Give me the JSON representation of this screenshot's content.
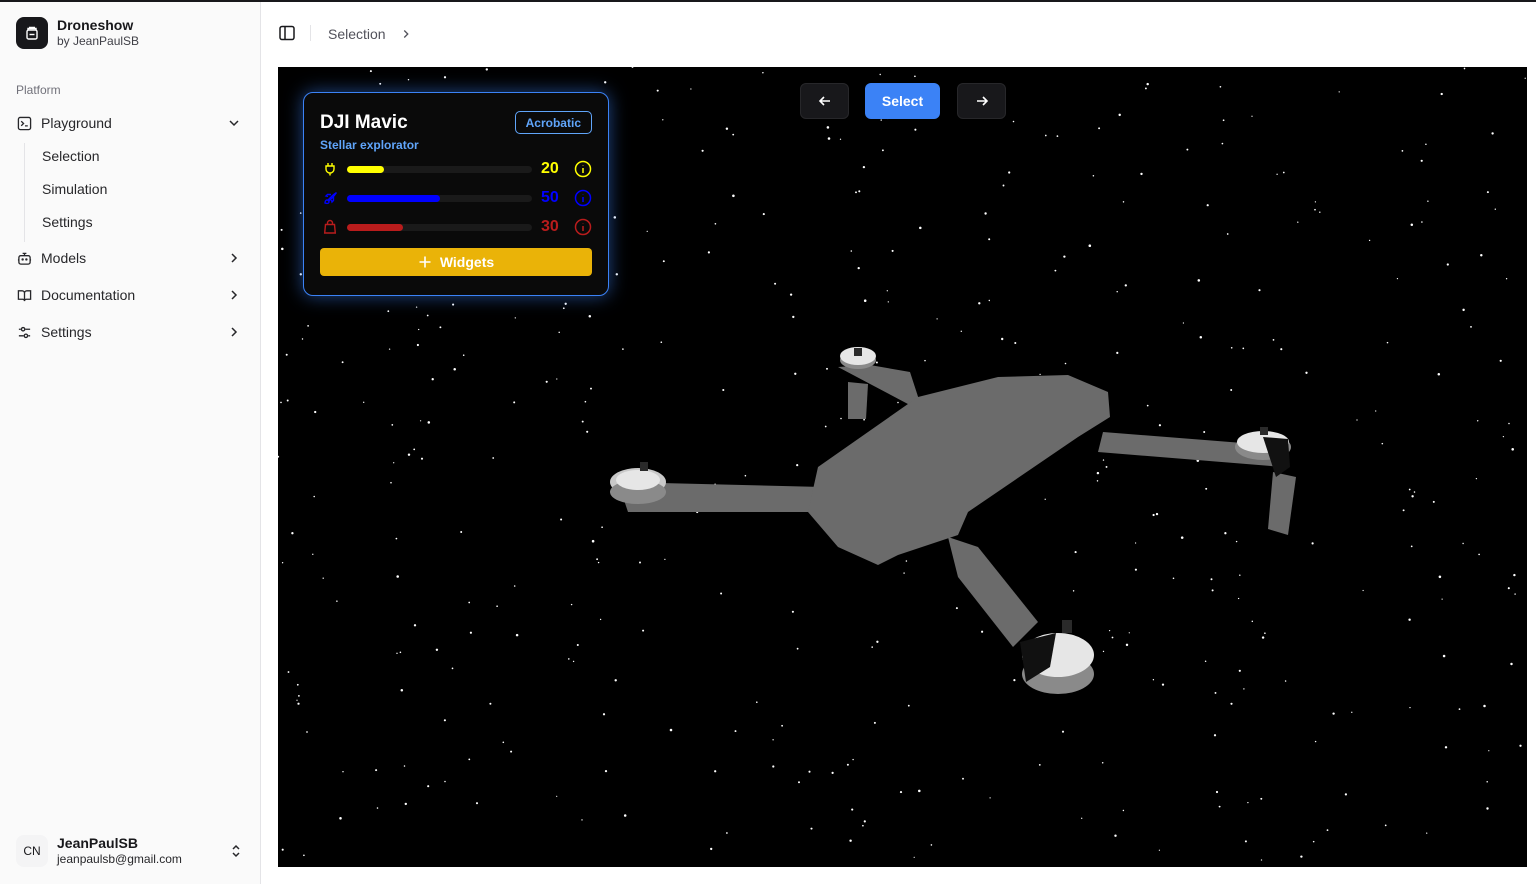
{
  "brand": {
    "name": "Droneshow",
    "subtitle": "by JeanPaulSB"
  },
  "sidebar": {
    "section_label": "Platform",
    "items": [
      {
        "label": "Playground",
        "icon": "terminal-square-icon",
        "expanded": true,
        "children": [
          {
            "label": "Selection"
          },
          {
            "label": "Simulation"
          },
          {
            "label": "Settings"
          }
        ]
      },
      {
        "label": "Models",
        "icon": "bot-icon"
      },
      {
        "label": "Documentation",
        "icon": "book-open-icon"
      },
      {
        "label": "Settings",
        "icon": "sliders-icon"
      }
    ]
  },
  "user": {
    "initials": "CN",
    "name": "JeanPaulSB",
    "email": "jeanpaulsb@gmail.com"
  },
  "header": {
    "breadcrumb": "Selection"
  },
  "scene": {
    "select_label": "Select",
    "card": {
      "title": "DJI Mavic",
      "badge": "Acrobatic",
      "subtitle": "Stellar explorator",
      "stats": [
        {
          "icon": "plug-icon",
          "value": "20",
          "percent": 20,
          "color": "#ffff00"
        },
        {
          "icon": "rocket-icon",
          "value": "50",
          "percent": 50,
          "color": "#0000ff"
        },
        {
          "icon": "shopping-bag-icon",
          "value": "30",
          "percent": 30,
          "color": "#b91c1c"
        }
      ],
      "widgets_label": "Widgets"
    }
  },
  "colors": {
    "accent": "#3b82f6",
    "widgets": "#eab308",
    "badge": "#60a5fa"
  }
}
